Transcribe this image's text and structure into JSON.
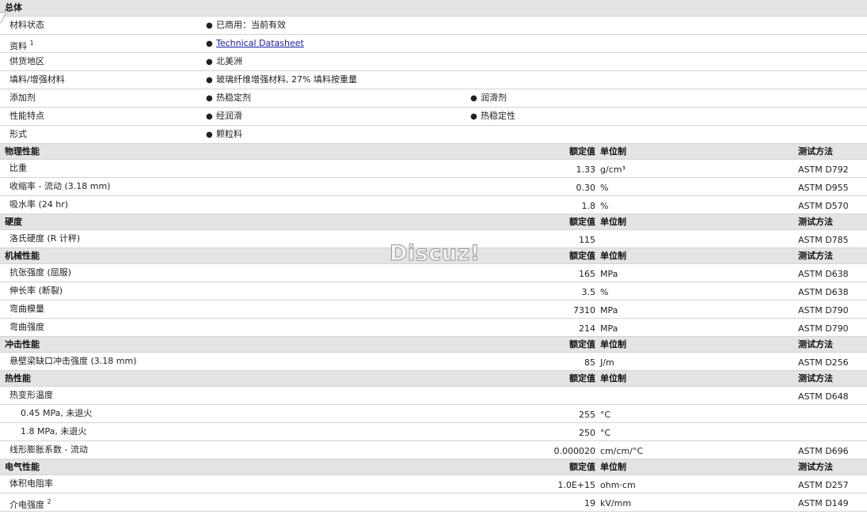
{
  "rows": [
    {
      "type": "header",
      "title": "总体",
      "h": 21
    },
    {
      "type": "bullets",
      "label": "材料状态",
      "items": [
        "已商用：当前有效"
      ],
      "h": 23
    },
    {
      "type": "link",
      "label": "资料",
      "sup": "1",
      "link": "Technical Datasheet",
      "h": 23
    },
    {
      "type": "bullets",
      "label": "供货地区",
      "items": [
        "北美洲"
      ],
      "h": 23
    },
    {
      "type": "bullets",
      "label": "填料/增强材料",
      "items": [
        "玻璃纤维增强材料, 27% 填料按重量"
      ],
      "h": 23
    },
    {
      "type": "bullets",
      "label": "添加剂",
      "items": [
        "热稳定剂",
        "润滑剂"
      ],
      "h": 23
    },
    {
      "type": "bullets",
      "label": "性能特点",
      "items": [
        "经润滑",
        "热稳定性"
      ],
      "h": 23
    },
    {
      "type": "bullets",
      "label": "形式",
      "items": [
        "颗粒料"
      ],
      "h": 23
    },
    {
      "type": "header",
      "title": "物理性能",
      "value": "额定值",
      "unit": "单位制",
      "method": "测试方法",
      "h": 20
    },
    {
      "type": "prop",
      "label": "比重",
      "value": "1.33",
      "unit": "g/cm³",
      "method": "ASTM D792",
      "h": 23
    },
    {
      "type": "prop",
      "label": "收缩率 - 流动 (3.18 mm)",
      "value": "0.30",
      "unit": "%",
      "method": "ASTM D955",
      "h": 23
    },
    {
      "type": "prop",
      "label": "吸水率 (24 hr)",
      "value": "1.8",
      "unit": "%",
      "method": "ASTM D570",
      "h": 23
    },
    {
      "type": "header",
      "title": "硬度",
      "value": "额定值",
      "unit": "单位制",
      "method": "测试方法",
      "h": 20
    },
    {
      "type": "prop",
      "label": "洛氏硬度 (R 计秤)",
      "value": "115",
      "unit": "",
      "method": "ASTM D785",
      "h": 23
    },
    {
      "type": "header",
      "title": "机械性能",
      "value": "额定值",
      "unit": "单位制",
      "method": "测试方法",
      "h": 20
    },
    {
      "type": "prop",
      "label": "抗张强度 (屈服)",
      "value": "165",
      "unit": "MPa",
      "method": "ASTM D638",
      "h": 23
    },
    {
      "type": "prop",
      "label": "伸长率 (断裂)",
      "value": "3.5",
      "unit": "%",
      "method": "ASTM D638",
      "h": 23
    },
    {
      "type": "prop",
      "label": "弯曲模量",
      "value": "7310",
      "unit": "MPa",
      "method": "ASTM D790",
      "h": 23
    },
    {
      "type": "prop",
      "label": "弯曲强度",
      "value": "214",
      "unit": "MPa",
      "method": "ASTM D790",
      "h": 23
    },
    {
      "type": "header",
      "title": "冲击性能",
      "value": "额定值",
      "unit": "单位制",
      "method": "测试方法",
      "h": 20
    },
    {
      "type": "prop",
      "label": "悬壁梁缺口冲击强度 (3.18 mm)",
      "value": "85",
      "unit": "J/m",
      "method": "ASTM D256",
      "h": 23
    },
    {
      "type": "header",
      "title": "热性能",
      "value": "额定值",
      "unit": "单位制",
      "method": "测试方法",
      "h": 20
    },
    {
      "type": "prop",
      "label": "热变形温度",
      "value": "",
      "unit": "",
      "method": "ASTM D648",
      "h": 23
    },
    {
      "type": "prop",
      "label": "0.45 MPa, 未退火",
      "sub": true,
      "value": "255",
      "unit": "°C",
      "method": "",
      "h": 23
    },
    {
      "type": "prop",
      "label": "1.8 MPa, 未退火",
      "sub": true,
      "value": "250",
      "unit": "°C",
      "method": "",
      "h": 23
    },
    {
      "type": "prop",
      "label": "线形膨胀系数 - 流动",
      "value": "0.000020",
      "unit": "cm/cm/°C",
      "method": "ASTM D696",
      "h": 23
    },
    {
      "type": "header",
      "title": "电气性能",
      "value": "额定值",
      "unit": "单位制",
      "method": "测试方法",
      "h": 20
    },
    {
      "type": "prop",
      "label": "体积电阻率",
      "value": "1.0E+15",
      "unit": "ohm·cm",
      "method": "ASTM D257",
      "h": 23
    },
    {
      "type": "prop",
      "label": "介电强度",
      "sup": "2",
      "value": "19",
      "unit": "kV/mm",
      "method": "ASTM D149",
      "h": 23
    }
  ],
  "watermark": "Discuz!"
}
